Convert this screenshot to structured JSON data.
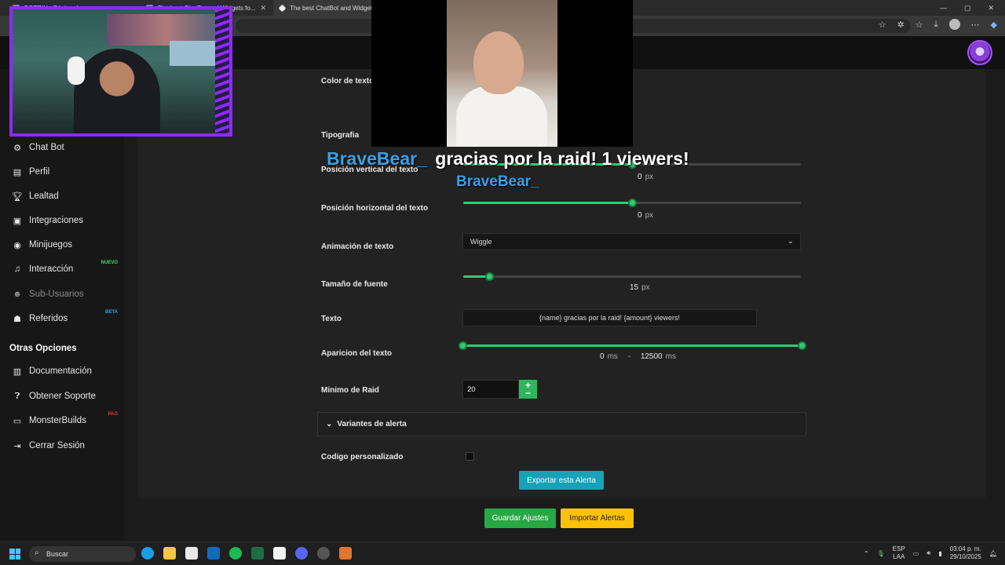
{
  "browser": {
    "tabs": [
      {
        "label": "BOTRIX - Página de..."
      },
      {
        "label": "The best ChatBot and Widgets fo..."
      },
      {
        "label": "The best ChatBot and Widgets fo..."
      }
    ]
  },
  "sidebar": {
    "items": [
      {
        "label": "Chat Bot",
        "icon": "robot-icon"
      },
      {
        "label": "Perfil",
        "icon": "id-card-icon"
      },
      {
        "label": "Lealtad",
        "icon": "trophy-icon"
      },
      {
        "label": "Integraciones",
        "icon": "plug-icon"
      },
      {
        "label": "Minijuegos",
        "icon": "gamepad-icon"
      },
      {
        "label": "Interacción",
        "icon": "music-icon",
        "badge": "NUEVO"
      },
      {
        "label": "Sub-Usuarios",
        "icon": "users-icon"
      },
      {
        "label": "Referidos",
        "icon": "user-group-icon",
        "badge": "BETA"
      }
    ],
    "section_title": "Otras Opciones",
    "other_items": [
      {
        "label": "Documentación",
        "icon": "book-icon"
      },
      {
        "label": "Obtener Soporte",
        "icon": "question-circle-icon"
      },
      {
        "label": "MonsterBuilds",
        "icon": "laptop-icon",
        "badge": "PAG"
      },
      {
        "label": "Cerrar Sesión",
        "icon": "logout-icon"
      }
    ]
  },
  "form": {
    "color_label": "Color de texto",
    "font_label": "Tipografia",
    "vpos": {
      "label": "Posición vertical del texto",
      "value": "0",
      "unit": "px",
      "fraction": 0.5
    },
    "hpos": {
      "label": "Posición horizontal del texto",
      "value": "0",
      "unit": "px",
      "fraction": 0.5
    },
    "animation": {
      "label": "Animación de texto",
      "selected": "Wiggle"
    },
    "font_size": {
      "label": "Tamaño de fuente",
      "value": "15",
      "unit": "px",
      "fraction": 0.076
    },
    "text": {
      "label": "Texto",
      "value": "{name} gracias por la raid! {amount} viewers!"
    },
    "appearance": {
      "label": "Aparicion del texto",
      "start": "0",
      "end": "12500",
      "unit": "ms",
      "separator": "-"
    },
    "min_raid": {
      "label": "Minimo de Raid",
      "value": "20"
    },
    "variants_label": "Variantes de alerta",
    "custom_code_label": "Codigo personalizado",
    "export_button": "Exportar esta Alerta",
    "save_button": "Guardar Ajustes",
    "import_button": "Importar Alertas"
  },
  "overlay": {
    "line1_name": "BraveBear_",
    "line1_message": "gracias por la raid! 1 viewers!",
    "line2_name": "BraveBear_"
  },
  "taskbar": {
    "search_placeholder": "Buscar",
    "lang": "ESP",
    "layout": "LAA",
    "time": "03:04 p. m.",
    "date": "29/10/2025"
  },
  "colors": {
    "accent_green": "#2ecc71",
    "overlay_name": "#3aa0e8",
    "overlay_text": "#ffffff",
    "cam_border": "#8b2cf5"
  }
}
